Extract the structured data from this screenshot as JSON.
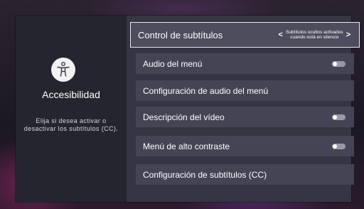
{
  "left_panel": {
    "title": "Accesibilidad",
    "description": "Elija si desea activar o desactivar los subtítulos (CC).",
    "icon": "accessibility-icon"
  },
  "menu": {
    "items": [
      {
        "label": "Control de subtítulos",
        "value_line1": "Subtítulos ocultos activados",
        "value_line2": "cuando está en silencio"
      },
      {
        "label": "Audio del menú",
        "toggle": "off"
      },
      {
        "label": "Configuración de audio del menú"
      },
      {
        "label": "Descripción del vídeo",
        "toggle": "off"
      },
      {
        "label": "Menú de alto contraste",
        "toggle": "off"
      },
      {
        "label": "Configuración de subtítulos (CC)"
      }
    ]
  },
  "colors": {
    "panel_left": "#25252f",
    "panel_right": "#353543",
    "item": "#444455",
    "focus_border": "#e8e8ee",
    "toggle_off": "#9a9aa6"
  }
}
